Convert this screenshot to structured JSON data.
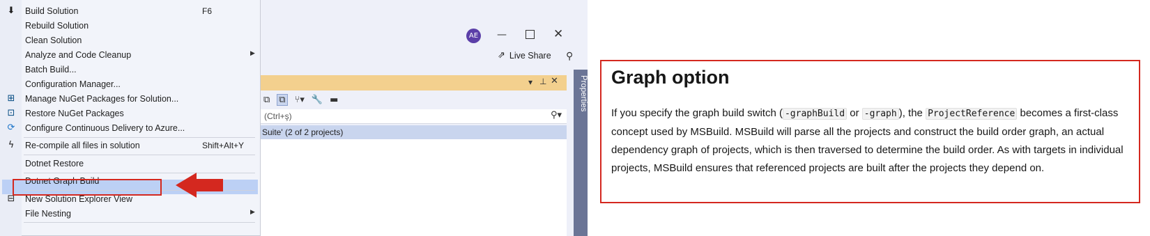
{
  "window": {
    "avatar_initials": "AE",
    "live_share_label": "Live Share",
    "search_placeholder": "(Ctrl+ş)",
    "solution_text": "Suite' (2 of 2 projects)",
    "properties_label": "Properties"
  },
  "menu": {
    "items": [
      {
        "label": "Build Solution",
        "shortcut": "F6",
        "icon": "build-icon"
      },
      {
        "label": "Rebuild Solution"
      },
      {
        "label": "Clean Solution"
      },
      {
        "label": "Analyze and Code Cleanup",
        "submenu": true
      },
      {
        "label": "Batch Build..."
      },
      {
        "label": "Configuration Manager..."
      },
      {
        "label": "Manage NuGet Packages for Solution...",
        "icon": "nuget-icon"
      },
      {
        "label": "Restore NuGet Packages",
        "icon": "restore-icon"
      },
      {
        "label": "Configure Continuous Delivery to Azure...",
        "icon": "azure-icon"
      },
      {
        "label": "Re-compile all files in solution",
        "shortcut": "Shift+Alt+Y",
        "icon": "lightning-icon"
      },
      {
        "label": "Dotnet Restore"
      },
      {
        "label": "Dotnet Graph Build",
        "highlighted": true
      },
      {
        "label": "New Solution Explorer View",
        "icon": "new-view-icon"
      },
      {
        "label": "File Nesting",
        "submenu": true
      }
    ]
  },
  "doc": {
    "title": "Graph option",
    "p_1": "If you specify the graph build switch (",
    "code_1": "-graphBuild",
    "p_2": " or ",
    "code_2": "-graph",
    "p_3": "), the ",
    "code_3": "ProjectReference",
    "p_4": " becomes a first-class concept used by MSBuild. MSBuild will parse all the projects and construct the build order graph, an actual dependency graph of projects, which is then traversed to determine the build order. As with targets in individual projects, MSBuild ensures that referenced projects are built after the projects they depend on."
  },
  "colors": {
    "highlight_border": "#d4281f",
    "menu_highlight": "#bcd0f5",
    "panel_title": "#f3d08e",
    "avatar": "#5b3fa8"
  }
}
